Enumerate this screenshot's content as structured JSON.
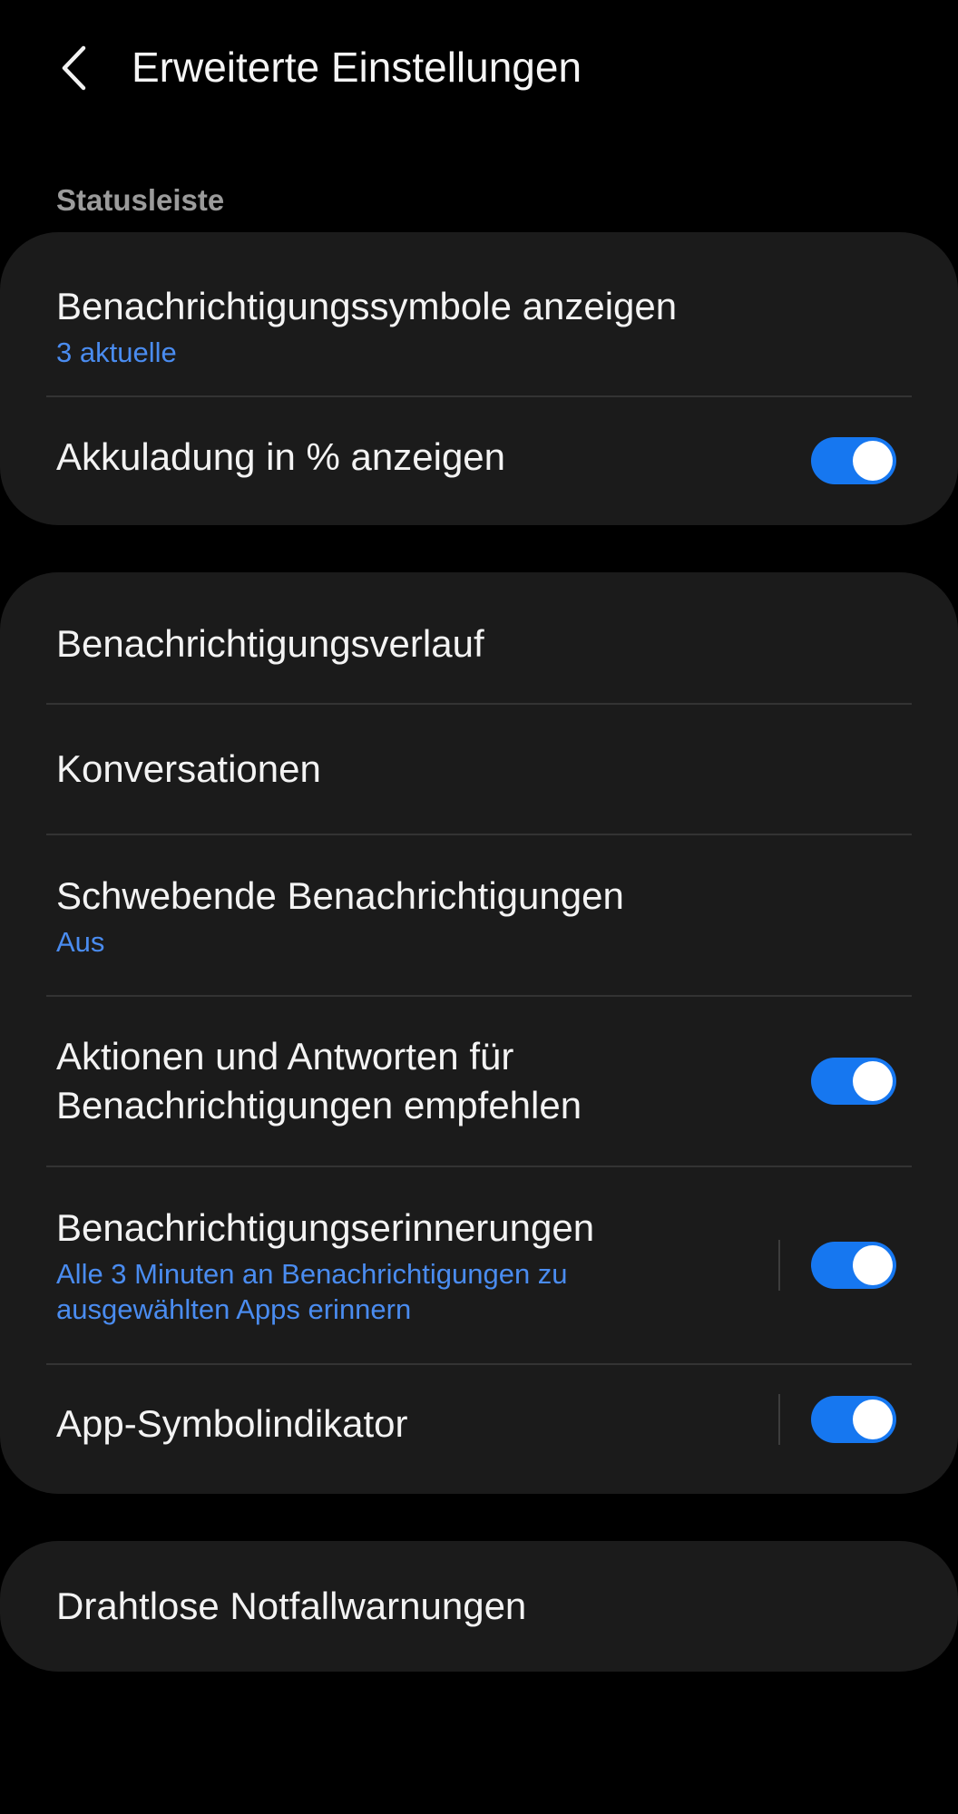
{
  "header": {
    "title": "Erweiterte Einstellungen",
    "back_icon": "chevron-left-icon"
  },
  "sections": {
    "status_bar": {
      "label": "Statusleiste",
      "items": [
        {
          "title": "Benachrichtigungssymbole anzeigen",
          "subtitle": "3 aktuelle"
        },
        {
          "title": "Akkuladung in % anzeigen",
          "toggle": true
        }
      ]
    },
    "notifications": {
      "items": [
        {
          "title": "Benachrichtigungsverlauf"
        },
        {
          "title": "Konversationen"
        },
        {
          "title": "Schwebende Benachrichtigungen",
          "subtitle": "Aus"
        },
        {
          "title_line1": "Aktionen und Antworten für",
          "title_line2": "Benachrichtigungen empfehlen",
          "toggle": true
        },
        {
          "title": "Benachrichtigungserinnerungen",
          "subtitle_line1": "Alle 3 Minuten an Benachrichtigungen zu",
          "subtitle_line2": "ausgewählten Apps erinnern",
          "toggle": true
        },
        {
          "title": "App-Symbolindikator",
          "toggle": true
        }
      ]
    },
    "alerts": {
      "items": [
        {
          "title": "Drahtlose Notfallwarnungen"
        }
      ]
    }
  },
  "colors": {
    "background": "#000000",
    "card": "#1b1b1b",
    "accent": "#1677f0",
    "subtitle": "#4a8cf0",
    "section_label": "#9b9b9b",
    "divider": "#333333"
  }
}
